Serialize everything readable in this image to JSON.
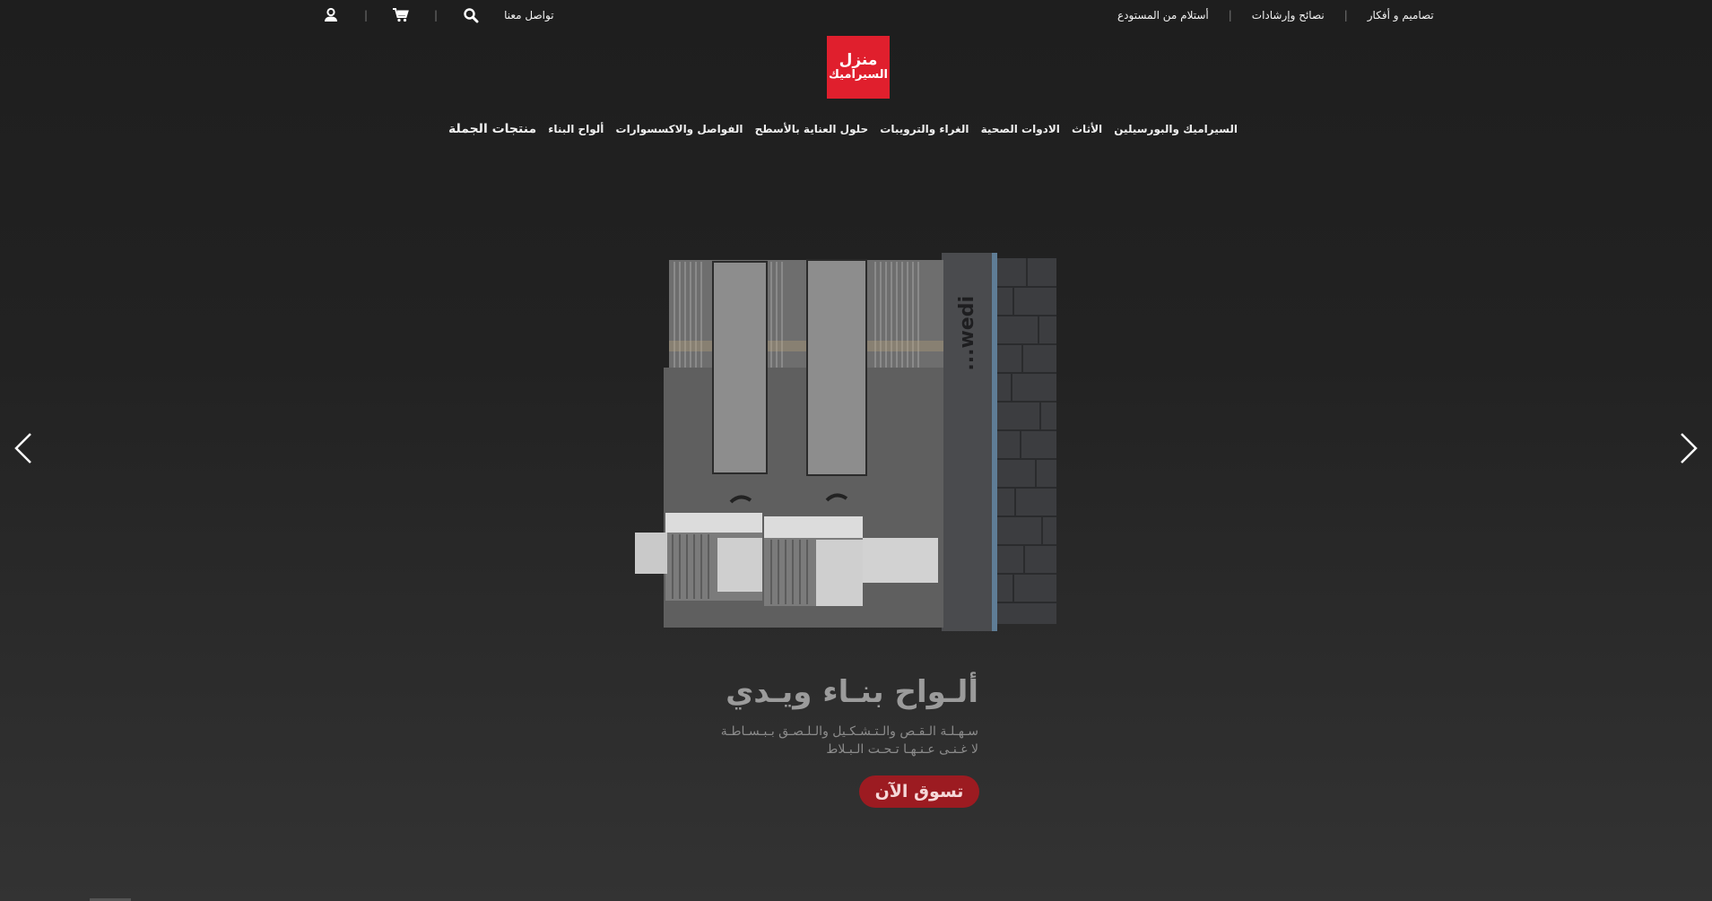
{
  "topbar": {
    "contact_label": "تواصل معنا",
    "links": [
      "تصاميم و أفكار",
      "نصائح وإرشادات",
      "أستلام من المستودع"
    ]
  },
  "logo": {
    "line1": "منزل",
    "line2": "السيراميك"
  },
  "nav": [
    "السيراميك والبورسيلين",
    "الأثاث",
    "الادوات الصحية",
    "الغراء والترويبات",
    "حلول العناية بالأسطح",
    "الفواصل والاكسسوارات",
    "ألواح البناء",
    "منتجات الجملة"
  ],
  "hero": {
    "title": "ألـواح بنـاء ويـدي",
    "subtitle_line1": "سـهـلـة الـقـص والـتـشـكـيل والـلـصـق بـبـسـاطـة",
    "subtitle_line2": "لا غـنـى عـنـهـا تـحـت الـبـلاط",
    "cta_label": "تسوق الآن",
    "brand_mark": "...wedi"
  },
  "icons": {
    "user": "user-icon",
    "cart": "cart-icon",
    "search": "search-icon",
    "prev": "chevron-left-icon",
    "next": "chevron-right-icon"
  },
  "colors": {
    "brand_red": "#e01f2d",
    "cta_red": "#9c1b21",
    "background": "#222222"
  }
}
